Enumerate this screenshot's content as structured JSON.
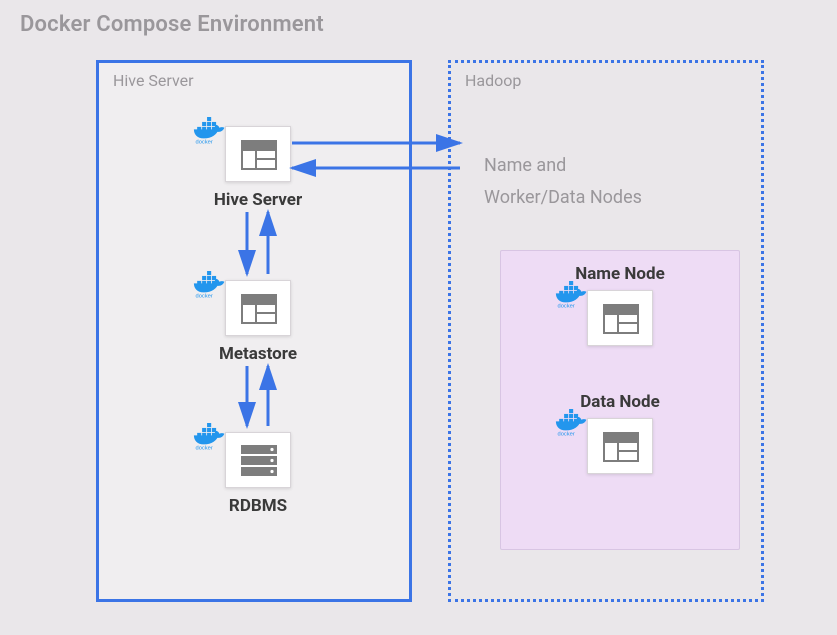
{
  "title": "Docker Compose Environment",
  "panels": {
    "hive": {
      "label": "Hive Server"
    },
    "hadoop": {
      "label": "Hadoop",
      "description_line1": "Name and",
      "description_line2": "Worker/Data Nodes"
    }
  },
  "nodes": {
    "hive_server": {
      "label": "Hive Server",
      "badge": "docker"
    },
    "metastore": {
      "label": "Metastore",
      "badge": "docker"
    },
    "rdbms": {
      "label": "RDBMS",
      "badge": "docker"
    },
    "name_node": {
      "label": "Name Node",
      "badge": "docker"
    },
    "data_node": {
      "label": "Data Node",
      "badge": "docker"
    }
  },
  "connections": [
    {
      "from": "hive_server",
      "to": "hadoop",
      "dir": "both"
    },
    {
      "from": "hive_server",
      "to": "metastore",
      "dir": "both"
    },
    {
      "from": "metastore",
      "to": "rdbms",
      "dir": "both"
    }
  ],
  "colors": {
    "panel_border": "#3b74e6",
    "arrow": "#3b74e6",
    "bg": "#eae7ea",
    "inner_panel": "#eedcf5",
    "text_muted": "#9a979b",
    "icon_gray": "#7d7d7d",
    "docker_blue": "#2396ed"
  }
}
